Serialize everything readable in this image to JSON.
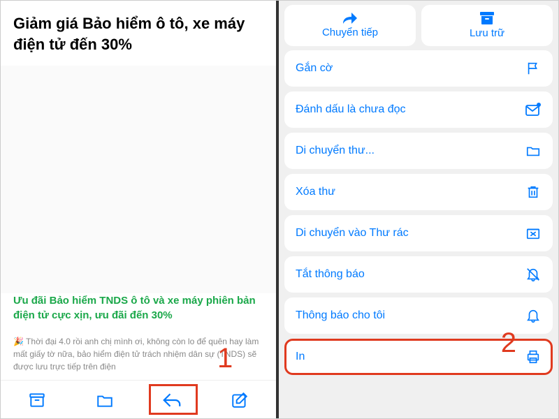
{
  "left": {
    "title": "Giảm giá Bảo hiểm ô tô, xe máy điện tử đến 30%",
    "promo_green": "Ưu đãi Bảo hiểm TNDS ô tô và xe máy phiên bản điện tử cực xịn, ưu đãi đến 30%",
    "promo_gray": "🎉 Thời đại 4.0 rồi anh chị mình ơi, không còn lo để quên hay làm mất giấy tờ nữa, bảo hiểm điện tử trách nhiệm dân sự (TNDS) sẽ được lưu trực tiếp trên điện",
    "step_label": "1"
  },
  "right": {
    "top": {
      "forward": "Chuyển tiếp",
      "archive": "Lưu trữ"
    },
    "items": [
      {
        "label": "Gắn cờ",
        "icon": "flag"
      },
      {
        "label": "Đánh dấu là chưa đọc",
        "icon": "unread"
      },
      {
        "label": "Di chuyển thư...",
        "icon": "folder"
      },
      {
        "label": "Xóa thư",
        "icon": "trash"
      },
      {
        "label": "Di chuyển vào Thư rác",
        "icon": "junk"
      },
      {
        "label": "Tắt thông báo",
        "icon": "bell-off"
      },
      {
        "label": "Thông báo cho tôi",
        "icon": "bell"
      },
      {
        "label": "In",
        "icon": "print"
      }
    ],
    "step_label": "2"
  }
}
